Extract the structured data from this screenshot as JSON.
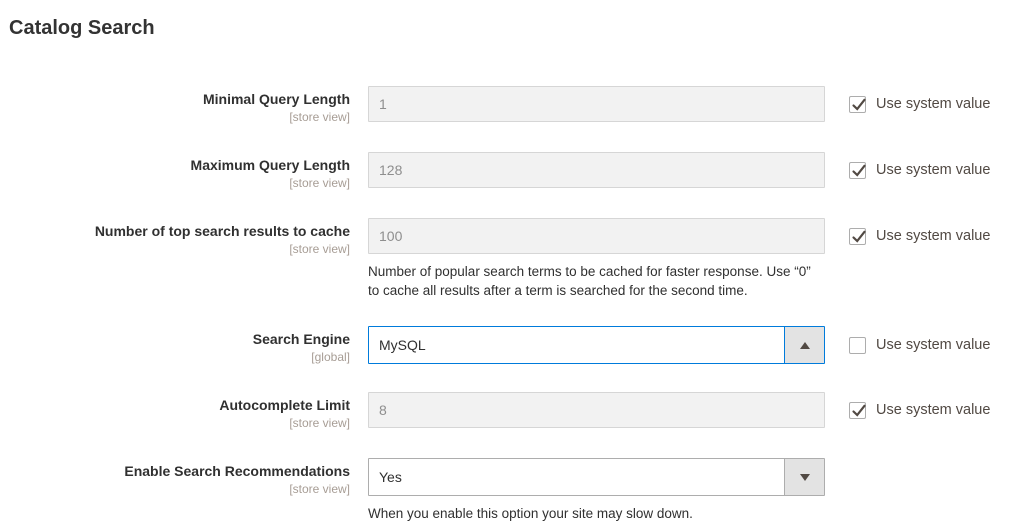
{
  "page": {
    "title": "Catalog Search"
  },
  "use_system_label": "Use system value",
  "colors": {
    "accent_focus_border": "#007bdb",
    "disabled_input_bg": "#f2f2f2",
    "select_button_bg": "#e3e3e3",
    "check_color": "#514943",
    "label_color": "#303030",
    "scope_color": "#a79d95"
  },
  "fields": [
    {
      "label": "Minimal Query Length",
      "scope": "[store view]",
      "value": "1",
      "control": "input-disabled",
      "use_system": "checked"
    },
    {
      "label": "Maximum Query Length",
      "scope": "[store view]",
      "value": "128",
      "control": "input-disabled",
      "use_system": "checked"
    },
    {
      "label": "Number of top search results to cache",
      "scope": "[store view]",
      "value": "100",
      "control": "input-disabled",
      "use_system": "checked",
      "note": "Number of popular search terms to be cached for faster response. Use “0” to cache all results after a term is searched for the second time."
    },
    {
      "label": "Search Engine",
      "scope": "[global]",
      "value": "MySQL",
      "control": "select-open",
      "use_system": "unchecked"
    },
    {
      "label": "Autocomplete Limit",
      "scope": "[store view]",
      "value": "8",
      "control": "input-disabled",
      "use_system": "checked"
    },
    {
      "label": "Enable Search Recommendations",
      "scope": "[store view]",
      "value": "Yes",
      "control": "select-closed",
      "use_system": "none",
      "note": "When you enable this option your site may slow down."
    }
  ]
}
